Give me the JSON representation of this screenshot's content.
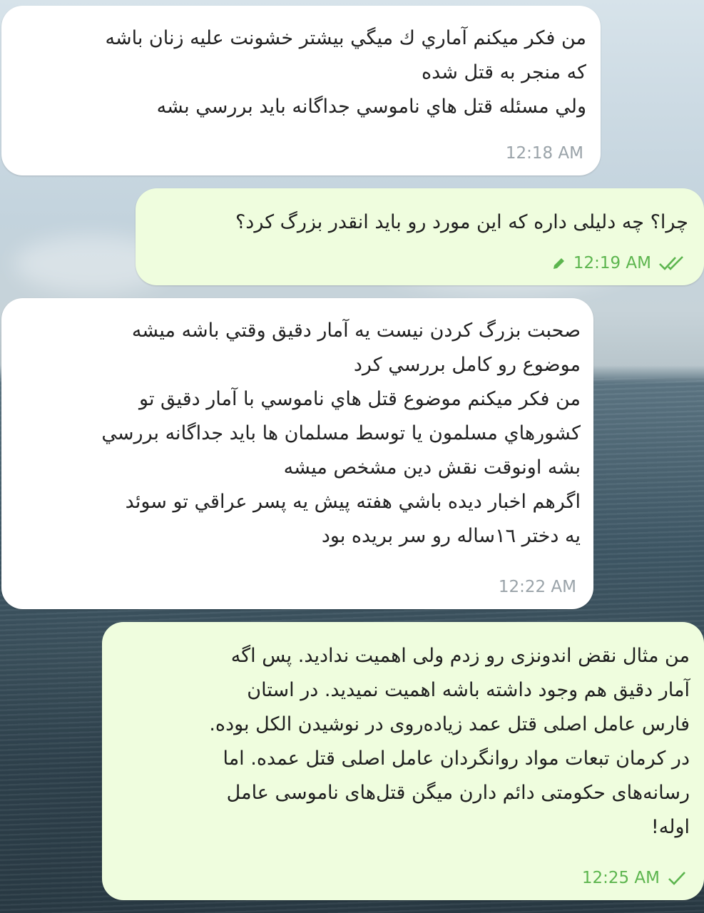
{
  "messages": [
    {
      "id": "m1",
      "direction": "incoming",
      "lines": [
        "من فكر ميكنم آماري ك ميگي بيشتر خشونت عليه زنان باشه",
        "كه منجر به قتل شده",
        "ولي مسئله قتل هاي ناموسي جداگانه بايد بررسي بشه"
      ],
      "time": "12:18 AM"
    },
    {
      "id": "m2",
      "direction": "outgoing",
      "lines": [
        "چرا؟ چه دلیلی داره که این مورد رو باید انقدر بزرگ کرد؟"
      ],
      "time": "12:19 AM",
      "edited_icon": "pencil-icon",
      "status_icon": "double-check-icon"
    },
    {
      "id": "m3",
      "direction": "incoming",
      "lines": [
        "صحبت بزرگ كردن نيست يه آمار دقيق وقتي باشه ميشه",
        "موضوع رو كامل بررسي كرد",
        "من فكر ميكنم موضوع قتل هاي ناموسي با آمار دقيق تو",
        "كشورهاي مسلمون يا توسط مسلمان ها بايد جداگانه بررسي",
        "بشه اونوقت نقش دين مشخص ميشه",
        "اگرهم اخبار ديده باشي هفته پيش يه پسر عراقي تو سوئد",
        "يه دختر ١٦ساله رو سر بريده بود"
      ],
      "time": "12:22 AM"
    },
    {
      "id": "m4",
      "direction": "outgoing",
      "lines": [
        "من مثال نقض اندونزی رو زدم ولی اهمیت ندادید. پس اگه",
        "آمار دقیق هم وجود داشته باشه اهمیت نمیدید. در استان",
        "فارس عامل اصلی قتل عمد زیاده‌روی در نوشیدن الکل بوده.",
        "در کرمان تبعات مواد روانگردان عامل اصلی قتل عمده. اما",
        "رسانه‌های حکومتی دائم دارن میگن قتل‌های ناموسی عامل",
        "اوله!"
      ],
      "time": "12:25 AM",
      "status_icon": "single-check-icon"
    }
  ],
  "colors": {
    "incoming_bubble": "#ffffff",
    "outgoing_bubble": "#effdde",
    "incoming_time": "#9aa3a9",
    "outgoing_time": "#5cb54e"
  }
}
